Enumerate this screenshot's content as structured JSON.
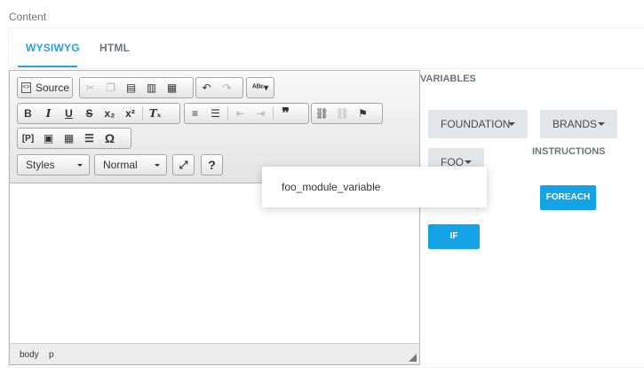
{
  "section_label": "Content",
  "tabs": [
    {
      "label": "WYSIWYG",
      "active": true
    },
    {
      "label": "HTML",
      "active": false
    }
  ],
  "toolbar": {
    "source_label": "Source",
    "styles_combo": "Styles",
    "format_combo": "Normal",
    "help_label": "?"
  },
  "statusbar": {
    "path": [
      "body",
      "p"
    ]
  },
  "variables": {
    "title": "VARIABLES",
    "buttons": [
      {
        "label": "FOUNDATION"
      },
      {
        "label": "BRANDS"
      },
      {
        "label": "FOO"
      }
    ],
    "dropdown_items": [
      "foo_module_variable"
    ]
  },
  "instructions": {
    "title": "INSTRUCTIONS",
    "foreach_label": "FOREACH",
    "if_label": "IF"
  },
  "colors": {
    "accent": "#2a9fd8",
    "primary_button": "#14a3e6",
    "variable_button_bg": "#e3e6e9"
  }
}
